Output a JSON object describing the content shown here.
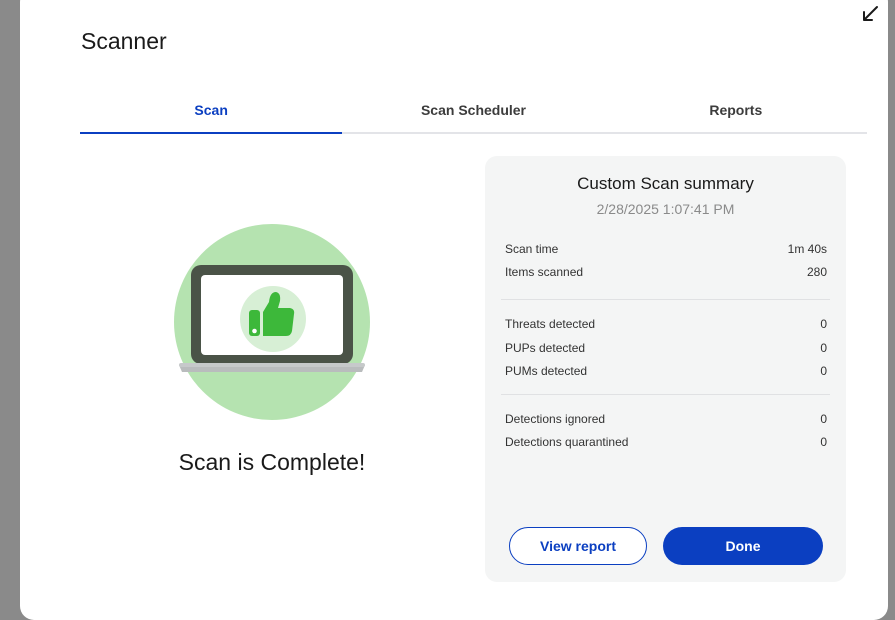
{
  "app": {
    "title": "Scanner"
  },
  "tabs": [
    {
      "label": "Scan",
      "active": true
    },
    {
      "label": "Scan Scheduler",
      "active": false
    },
    {
      "label": "Reports",
      "active": false
    }
  ],
  "scan": {
    "status_text": "Scan is Complete!"
  },
  "summary": {
    "title": "Custom Scan summary",
    "date": "2/28/2025 1:07:41 PM",
    "groups": [
      [
        {
          "label": "Scan time",
          "value": "1m 40s"
        },
        {
          "label": "Items scanned",
          "value": "280"
        }
      ],
      [
        {
          "label": "Threats detected",
          "value": "0"
        },
        {
          "label": "PUPs detected",
          "value": "0"
        },
        {
          "label": "PUMs detected",
          "value": "0"
        }
      ],
      [
        {
          "label": "Detections ignored",
          "value": "0"
        },
        {
          "label": "Detections quarantined",
          "value": "0"
        }
      ]
    ],
    "view_report_label": "View report",
    "done_label": "Done"
  },
  "icons": {
    "collapse": "arrow-down-left-icon",
    "illustration": "laptop-thumbs-up-icon"
  },
  "colors": {
    "accent": "#0b3fc1",
    "success_circle": "#b5e3b0",
    "thumb": "#3db83a",
    "panel_bg": "#f4f5f5"
  }
}
